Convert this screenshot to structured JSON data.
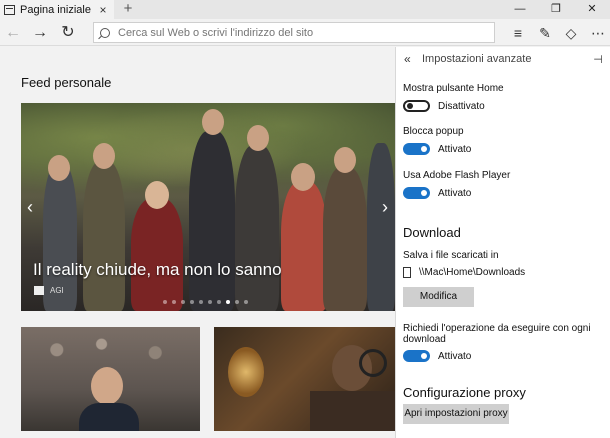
{
  "browser": {
    "tab_title": "Pagina iniziale",
    "tab_close": "×",
    "new_tab": "+",
    "window_controls": {
      "minimize": "—",
      "maximize": "❐",
      "close": "✕"
    }
  },
  "navbar": {
    "back": "←",
    "forward": "→",
    "refresh": "↻",
    "address_placeholder": "Cerca sul Web o scrivi l'indirizzo del sito",
    "tools": {
      "reading_view": "≡",
      "notes": "✎",
      "share": "◇",
      "more": "⋯"
    }
  },
  "feed": {
    "title": "Feed personale",
    "hero": {
      "headline": "Il reality chiude, ma non lo sanno",
      "source": "AGI",
      "prev": "‹",
      "next": "›",
      "slide_count": 10,
      "active_slide": 8
    }
  },
  "settings": {
    "header": {
      "back": "«",
      "title": "Impostazioni avanzate",
      "pin": "⊣"
    },
    "home_button": {
      "label": "Mostra pulsante Home",
      "state": "Disattivato",
      "on": false
    },
    "popup_block": {
      "label": "Blocca popup",
      "state": "Attivato",
      "on": true
    },
    "flash": {
      "label": "Usa Adobe Flash Player",
      "state": "Attivato",
      "on": true
    },
    "download": {
      "heading": "Download",
      "save_label": "Salva i file scaricati in",
      "path": "\\\\Mac\\Home\\Downloads",
      "change_button": "Modifica",
      "ask_label_line1": "Richiedi l'operazione da eseguire con ogni",
      "ask_label_line2": "download",
      "ask_state": "Attivato",
      "ask_on": true
    },
    "proxy": {
      "heading": "Configurazione proxy",
      "button": "Apri impostazioni proxy"
    }
  },
  "colors": {
    "accent": "#1a73c8",
    "panel_bg": "#ffffff",
    "page_bg": "#f2f2f2",
    "button_gray": "#cfcfcf"
  },
  "icons": {
    "tab": "page-icon",
    "back": "back-arrow-icon",
    "forward": "forward-arrow-icon",
    "refresh": "refresh-icon",
    "search": "search-icon",
    "reading": "reading-list-icon",
    "notes": "web-note-icon",
    "share": "share-icon",
    "more": "more-icon",
    "panel_back": "double-chevron-left-icon",
    "pin": "pin-icon",
    "folder": "folder-icon"
  }
}
